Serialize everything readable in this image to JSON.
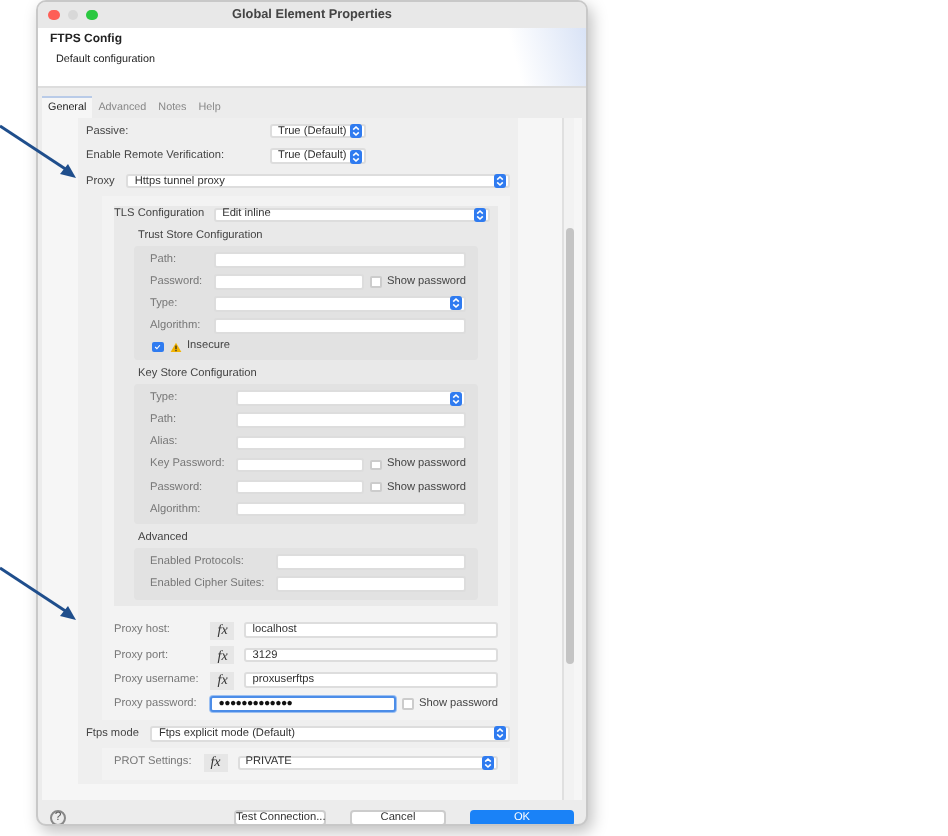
{
  "window": {
    "title": "Global Element Properties"
  },
  "header": {
    "title": "FTPS Config",
    "subtitle": "Default configuration"
  },
  "tabs": [
    {
      "label": "General",
      "selected": true
    },
    {
      "label": "Advanced",
      "selected": false
    },
    {
      "label": "Notes",
      "selected": false
    },
    {
      "label": "Help",
      "selected": false
    }
  ],
  "rows": [
    {
      "kind": "short-select",
      "label": "Passive:",
      "value": "True (Default)"
    },
    {
      "kind": "short-select",
      "label": "Enable Remote Verification:",
      "value": "True (Default)"
    },
    {
      "kind": "select",
      "label": "Proxy",
      "value": "Https tunnel proxy",
      "children": [
        {
          "kind": "section",
          "label": "TLS Configuration",
          "value": "Edit inline",
          "children": [
            {
              "kind": "group",
              "title": "Trust Store Configuration",
              "children": [
                {
                  "kind": "text",
                  "label": "Path:"
                },
                {
                  "kind": "password",
                  "label": "Password:",
                  "show_label": "Show password",
                  "checked": false
                },
                {
                  "kind": "select",
                  "label": "Type:"
                },
                {
                  "kind": "text",
                  "label": "Algorithm:"
                },
                {
                  "kind": "checkbox",
                  "label": "Insecure",
                  "checked": true,
                  "warning": true
                }
              ]
            },
            {
              "kind": "group",
              "title": "Key Store Configuration",
              "children": [
                {
                  "kind": "select",
                  "label": "Type:"
                },
                {
                  "kind": "text",
                  "label": "Path:"
                },
                {
                  "kind": "text",
                  "label": "Alias:"
                },
                {
                  "kind": "password",
                  "label": "Key Password:",
                  "show_label": "Show password",
                  "checked": false
                },
                {
                  "kind": "password",
                  "label": "Password:",
                  "show_label": "Show password",
                  "checked": false
                },
                {
                  "kind": "text",
                  "label": "Algorithm:"
                }
              ]
            },
            {
              "kind": "group",
              "title": "Advanced",
              "children": [
                {
                  "kind": "text",
                  "label": "Enabled Protocols:"
                },
                {
                  "kind": "text",
                  "label": "Enabled Cipher Suites:"
                }
              ]
            }
          ]
        },
        {
          "kind": "expression",
          "label": "Proxy host:",
          "fx": "fx",
          "value": "localhost"
        },
        {
          "kind": "expression",
          "label": "Proxy port:",
          "fx": "fx",
          "value": "3129"
        },
        {
          "kind": "expression",
          "label": "Proxy username:",
          "fx": "fx",
          "value": "proxuserftps"
        },
        {
          "kind": "password",
          "label": "Proxy password:",
          "value": "●●●●●●●●●●●●●",
          "focused": true,
          "show_label": "Show password",
          "checked": false
        }
      ]
    },
    {
      "kind": "select",
      "label": "Ftps mode",
      "value": "Ftps explicit mode (Default)",
      "children": [
        {
          "kind": "expression-select",
          "label": "PROT Settings:",
          "fx": "fx",
          "value": "PRIVATE"
        }
      ]
    }
  ],
  "help": "?",
  "buttons": [
    {
      "label": "Test Connection...",
      "primary": false
    },
    {
      "label": "Cancel",
      "primary": false
    },
    {
      "label": "OK",
      "primary": true
    }
  ]
}
